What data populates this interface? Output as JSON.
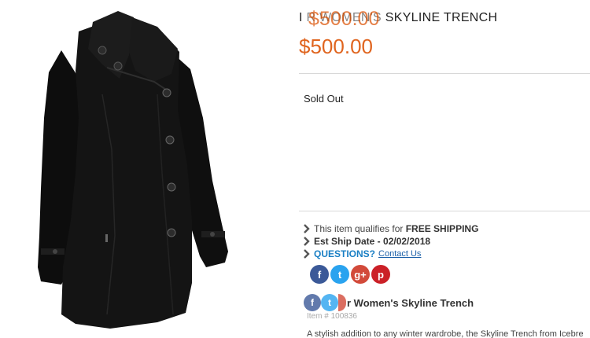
{
  "product": {
    "title_visible": "I             R WOMEN'S SKYLINE TRENCH",
    "title_overlay_price": "$500.00",
    "price": "$500.00",
    "stock_status": "Sold Out",
    "item_number": "Item # 100836",
    "sub_title": "r Women's Skyline Trench",
    "description": "A stylish addition to any winter wardrobe, the Skyline Trench from Icebre"
  },
  "shipping": {
    "free_prefix": "This item qualifies for",
    "free_label": "FREE SHIPPING",
    "ship_date": "Est Ship Date - 02/02/2018",
    "questions_label": "QUESTIONS?",
    "contact_link": "Contact Us"
  },
  "share_icons": {
    "facebook": "f",
    "twitter": "t",
    "googleplus": "g+",
    "pinterest": "p"
  },
  "colors": {
    "price": "#e0651f",
    "link": "#1a7fc4",
    "coat": "#111111"
  },
  "icons": [
    "chevron-right-icon",
    "facebook-icon",
    "twitter-icon",
    "google-plus-icon",
    "pinterest-icon",
    "coat-image"
  ]
}
